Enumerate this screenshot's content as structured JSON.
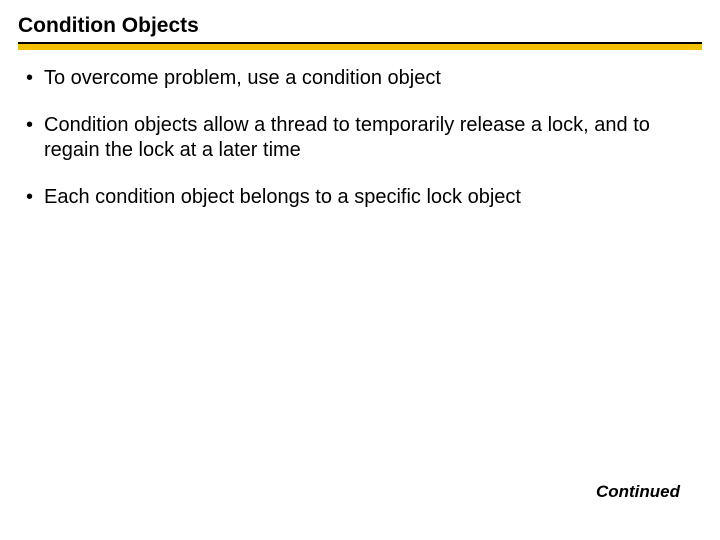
{
  "slide": {
    "title": "Condition Objects",
    "bullets": [
      "To overcome problem, use a condition object",
      "Condition objects allow a thread to temporarily release a lock, and to regain the lock at a later time",
      "Each condition object belongs to a specific lock object"
    ],
    "footer": "Continued"
  }
}
